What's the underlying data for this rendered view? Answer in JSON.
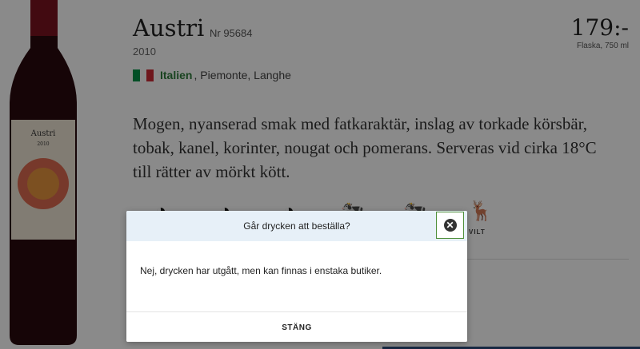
{
  "product": {
    "name": "Austri",
    "nr": "Nr 95684",
    "year": "2010",
    "country": "Italien",
    "region": ", Piemonte, Langhe",
    "price": "179:-",
    "size": "Flaska, 750 ml",
    "description": "Mogen, nyanserad smak med fatkaraktär, inslag av torkade körsbär, tobak, kanel, korinter, nougat och pomerans. Serveras vid cirka 18°C till rätter av mörkt kött."
  },
  "bottle_label": {
    "name": "Austri",
    "year": "2010"
  },
  "flag_colors": [
    "#009246",
    "#ffffff",
    "#ce2b37"
  ],
  "taste_icons": [
    "clock-icon",
    "clock-icon",
    "clock-icon",
    "cattle-icon",
    "cattle-icon",
    "moose-icon"
  ],
  "taste_label": "VILT",
  "modal": {
    "title": "Går drycken att beställa?",
    "body": "Nej, drycken har utgått, men kan finnas i enstaka butiker.",
    "close_label": "STÄNG"
  }
}
